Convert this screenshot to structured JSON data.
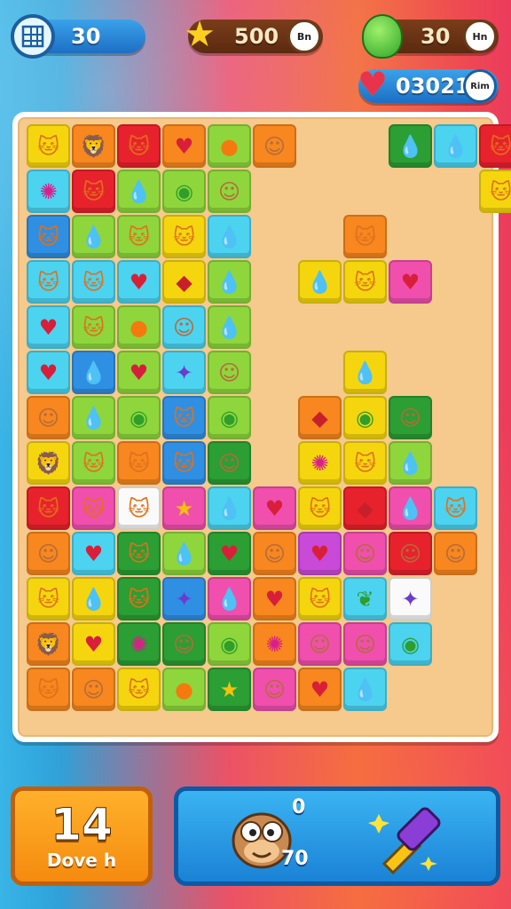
{
  "hud": {
    "moves_counter": {
      "icon": "grid-icon",
      "value": "30"
    },
    "star_score": {
      "icon": "star-icon",
      "value": "500",
      "button": "Bn"
    },
    "gem_count": {
      "icon": "green-gem-icon",
      "value": "30",
      "button": "Hn"
    },
    "heart_score": {
      "icon": "heart-gem-icon",
      "value": "03021",
      "button": "Rim"
    }
  },
  "bottom": {
    "moves_value": "14",
    "moves_label": "Dove h",
    "booster_counts": {
      "top": "0",
      "bottom": "70"
    },
    "booster_icons": [
      "monkey-face-icon",
      "hammer-icon"
    ]
  },
  "colors": {
    "yellow": "#f5d60e",
    "orange": "#f7871e",
    "red": "#e8222c",
    "green": "#8ed63c",
    "dkgreen": "#2b9e34",
    "blue": "#2f8fe3",
    "cyan": "#4cd3f0",
    "pink": "#f04fae",
    "magenta": "#c94ad8",
    "white": "#fafafa"
  },
  "board": {
    "rows": [
      [
        "Y:cat",
        "O:lion",
        "R:cat",
        "O:heart",
        "G:orange",
        "O:face",
        "_",
        "_",
        "DG:drop",
        "CY:drop",
        "R:cat"
      ],
      [
        "CY:splat",
        "R:cat",
        "G:drop",
        "G:lime",
        "G:face",
        "_",
        "_",
        "_",
        "_",
        "_",
        "Y:cat"
      ],
      [
        "B:cat",
        "G:drop",
        "G:cat",
        "Y:cat",
        "CY:drop",
        "_",
        "_",
        "O:cat",
        "_",
        "_",
        "_"
      ],
      [
        "CY:cat",
        "CY:cat",
        "CY:heart",
        "Y:bag",
        "G:drop",
        "_",
        "Y:drop",
        "Y:cat",
        "P:heart",
        "_",
        "_"
      ],
      [
        "CY:heart",
        "G:cat",
        "G:orange",
        "CY:face",
        "G:drop",
        "_",
        "_",
        "_",
        "_",
        "_",
        "_"
      ],
      [
        "CY:heart",
        "B:drop",
        "G:heart",
        "CY:bird",
        "G:face",
        "_",
        "_",
        "Y:drop",
        "_",
        "_",
        "_"
      ],
      [
        "O:face",
        "G:drop",
        "G:lime",
        "B:cat",
        "G:lime",
        "_",
        "O:bag",
        "Y:lime",
        "DG:face",
        "_",
        "_"
      ],
      [
        "Y:lion",
        "G:cat",
        "O:cat",
        "B:cat",
        "DG:face",
        "_",
        "Y:splat",
        "Y:cat",
        "G:drop",
        "_",
        "_"
      ],
      [
        "R:cat",
        "P:cat",
        "W:cat",
        "P:star",
        "CY:drop",
        "P:heart",
        "Y:cat",
        "R:bag",
        "P:drop",
        "CY:cat",
        "_"
      ],
      [
        "O:face",
        "CY:heart",
        "DG:cat",
        "G:drop",
        "DG:heart",
        "O:face",
        "M:heart",
        "P:face",
        "R:face",
        "O:face",
        "_"
      ],
      [
        "Y:cat",
        "Y:drop",
        "DG:cat",
        "B:bird",
        "P:drop",
        "O:heart",
        "Y:cat",
        "CY:leaf",
        "W:bird",
        "_",
        "_"
      ],
      [
        "O:lion",
        "Y:heart",
        "DG:splat",
        "DG:face",
        "G:lime",
        "O:splat",
        "P:face",
        "P:face",
        "CY:lime",
        "_",
        "_"
      ],
      [
        "O:cat",
        "O:face",
        "Y:cat",
        "G:orange",
        "DG:star",
        "P:face",
        "O:heart",
        "CY:drop",
        "_",
        "_",
        "_"
      ]
    ]
  }
}
